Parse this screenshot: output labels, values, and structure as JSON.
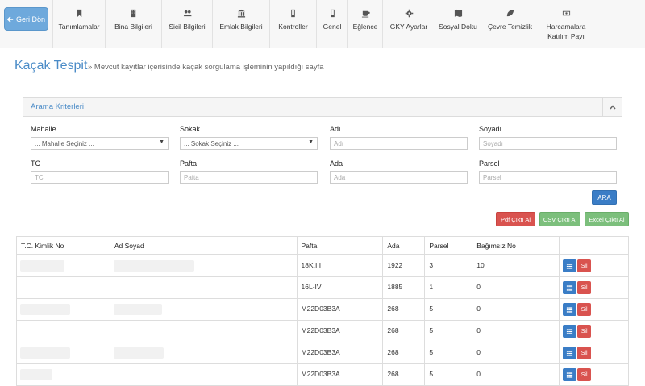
{
  "nav": {
    "back_label": "Geri Dön",
    "items": [
      {
        "label": "Tanımlamalar",
        "icon": "bookmark-icon",
        "width": 65
      },
      {
        "label": "Bina Bilgileri",
        "icon": "building-icon",
        "width": 70
      },
      {
        "label": "Sicil Bilgileri",
        "icon": "users-icon",
        "width": 63
      },
      {
        "label": "Emlak Bilgileri",
        "icon": "bank-icon",
        "width": 71
      },
      {
        "label": "Kontroller",
        "icon": "phone-icon",
        "width": 58
      },
      {
        "label": "Genel",
        "icon": "phone-icon",
        "width": 39
      },
      {
        "label": "Eğlence",
        "icon": "coffee-icon",
        "width": 43
      },
      {
        "label": "GKY Ayarlar",
        "icon": "gear-icon",
        "width": 65
      },
      {
        "label": "Sosyal Doku",
        "icon": "map-icon",
        "width": 57
      },
      {
        "label": "Çevre Temizlik",
        "icon": "leaf-icon",
        "width": 72
      },
      {
        "label": "Harcamalara Katılım Payı",
        "icon": "money-icon",
        "width": 68
      }
    ]
  },
  "page": {
    "title": "Kaçak Tespit",
    "description": "» Mevcut kayıtlar içerisinde kaçak sorgulama işleminin yapıldığı sayfa"
  },
  "search": {
    "panel_title": "Arama Kriterleri",
    "fields": {
      "mahalle": {
        "label": "Mahalle",
        "value": "... Mahalle Seçiniz ..."
      },
      "sokak": {
        "label": "Sokak",
        "value": "... Sokak Seçiniz ..."
      },
      "adi": {
        "label": "Adı",
        "placeholder": "Adı"
      },
      "soyadi": {
        "label": "Soyadı",
        "placeholder": "Soyadı"
      },
      "tc": {
        "label": "TC",
        "placeholder": "TC"
      },
      "pafta": {
        "label": "Pafta",
        "placeholder": "Pafta"
      },
      "ada": {
        "label": "Ada",
        "placeholder": "Ada"
      },
      "parsel": {
        "label": "Parsel",
        "placeholder": "Parsel"
      }
    },
    "ara_label": "ARA"
  },
  "export": {
    "pdf_label": "Pdf Çıktı Al",
    "csv_label": "CSV Çıktı Al",
    "excel_label": "Excel Çıktı Al"
  },
  "table": {
    "headers": [
      "T.C. Kimlik No",
      "Ad Soyad",
      "Pafta",
      "Ada",
      "Parsel",
      "Bağımsız No",
      ""
    ],
    "delete_label": "Sil",
    "rows": [
      {
        "pafta": "18K.III",
        "ada": "1922",
        "parsel": "3",
        "bagimsiz_no": "10"
      },
      {
        "pafta": "16L-IV",
        "ada": "1885",
        "parsel": "1",
        "bagimsiz_no": "0"
      },
      {
        "pafta": "M22D03B3A",
        "ada": "268",
        "parsel": "5",
        "bagimsiz_no": "0"
      },
      {
        "pafta": "M22D03B3A",
        "ada": "268",
        "parsel": "5",
        "bagimsiz_no": "0"
      },
      {
        "pafta": "M22D03B3A",
        "ada": "268",
        "parsel": "5",
        "bagimsiz_no": "0"
      },
      {
        "pafta": "M22D03B3A",
        "ada": "268",
        "parsel": "5",
        "bagimsiz_no": "0"
      }
    ]
  },
  "colors": {
    "accent": "#4a8bc7",
    "primary_button": "#3a7dc6",
    "danger": "#d9534f",
    "success": "#7cbf7c"
  }
}
